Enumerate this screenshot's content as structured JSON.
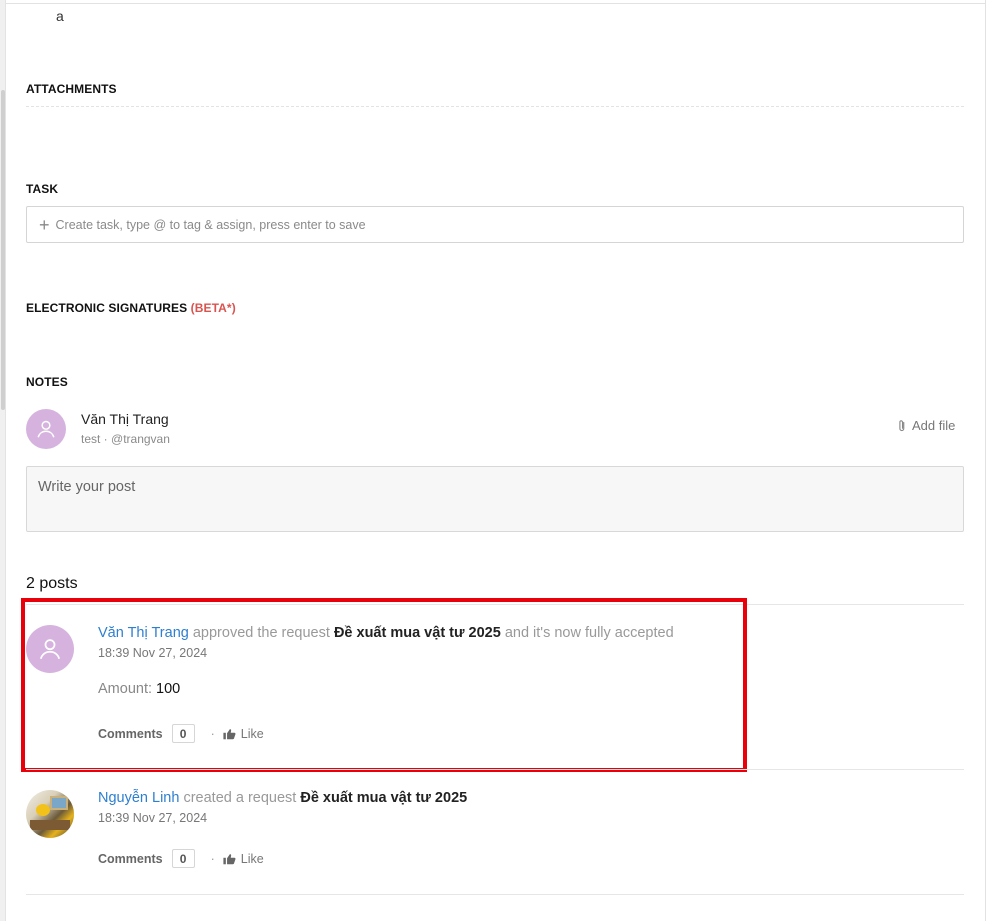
{
  "top_text": "a",
  "sections": {
    "attachments": "ATTACHMENTS",
    "task": "TASK",
    "signatures": "ELECTRONIC SIGNATURES",
    "signatures_beta": "(BETA*)",
    "notes": "NOTES"
  },
  "task_input": {
    "placeholder": "Create task, type @ to tag & assign, press enter to save"
  },
  "composer": {
    "user_name": "Văn Thị Trang",
    "user_sub": "test · @trangvan",
    "add_file_label": "Add file",
    "post_placeholder": "Write your post"
  },
  "posts_count_label": "2 posts",
  "posts": [
    {
      "author": "Văn Thị Trang",
      "action": "approved the request",
      "request": "Đề xuất mua vật tư 2025",
      "suffix": "and it's now fully accepted",
      "time": "18:39 Nov 27, 2024",
      "amount_label": "Amount:",
      "amount_value": "100",
      "comments_label": "Comments",
      "comments_count": "0",
      "separator": "·",
      "like_label": "Like",
      "avatar": "default-user-icon",
      "highlighted": true
    },
    {
      "author": "Nguyễn Linh",
      "action": "created a request",
      "request": "Đề xuất mua vật tư 2025",
      "time": "18:39 Nov 27, 2024",
      "comments_label": "Comments",
      "comments_count": "0",
      "separator": "·",
      "like_label": "Like",
      "avatar": "photo"
    }
  ],
  "colors": {
    "link": "#2d7fd0",
    "beta": "#d9534f",
    "highlight_border": "#e8000b",
    "avatar_bg": "#d5b3de"
  }
}
